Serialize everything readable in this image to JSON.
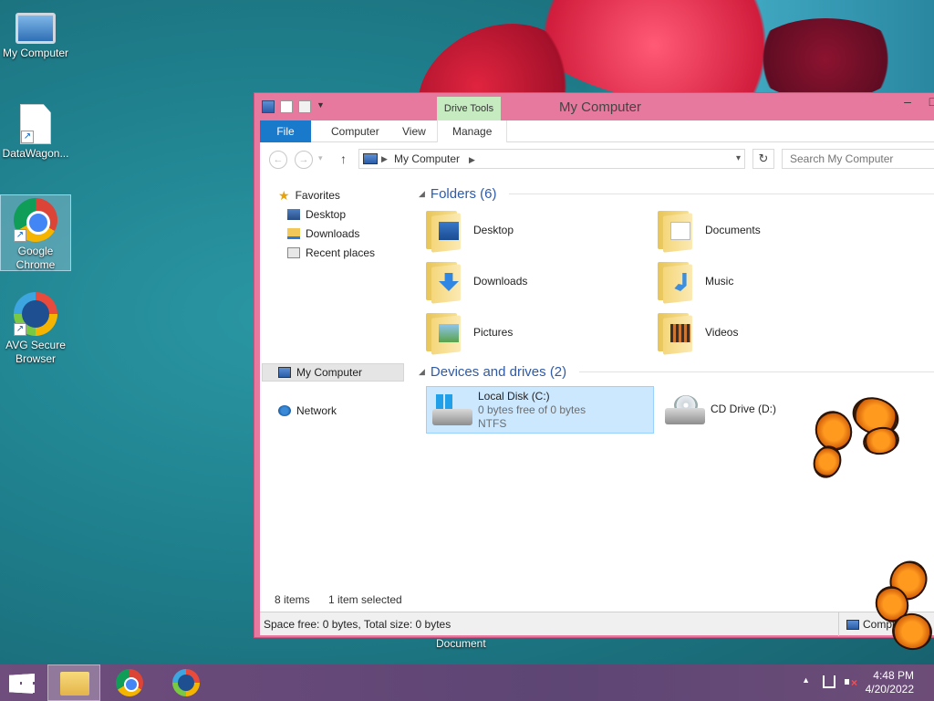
{
  "desktop": {
    "icons": [
      {
        "label": "My Computer"
      },
      {
        "label": "DataWagon..."
      },
      {
        "label": "Google Chrome"
      },
      {
        "label": "AVG Secure Browser"
      }
    ],
    "below_window_label": "Document"
  },
  "window": {
    "title": "My Computer",
    "context_tab": "Drive Tools",
    "controls": {
      "minimize": "–",
      "maximize": "□"
    },
    "ribbon_tabs": [
      {
        "label": "File"
      },
      {
        "label": "Computer"
      },
      {
        "label": "View"
      },
      {
        "label": "Manage"
      }
    ],
    "address": {
      "path": "My Computer",
      "back": "←",
      "forward": "→",
      "recent": "▾",
      "up": "↑",
      "dropdown": "▾",
      "refresh": "↻"
    },
    "search": {
      "placeholder": "Search My Computer"
    },
    "nav_pane": {
      "favorites_label": "Favorites",
      "favorites": [
        {
          "label": "Desktop"
        },
        {
          "label": "Downloads"
        },
        {
          "label": "Recent places"
        }
      ],
      "computer_label": "My Computer",
      "network_label": "Network"
    },
    "folders_group": {
      "header": "Folders (6)",
      "items": [
        {
          "label": "Desktop"
        },
        {
          "label": "Documents"
        },
        {
          "label": "Downloads"
        },
        {
          "label": "Music"
        },
        {
          "label": "Pictures"
        },
        {
          "label": "Videos"
        }
      ]
    },
    "drives_group": {
      "header": "Devices and drives (2)",
      "local_disk": {
        "name": "Local Disk (C:)",
        "space": "0 bytes free of 0 bytes",
        "fs": "NTFS"
      },
      "cd_drive": {
        "name": "CD Drive (D:)"
      }
    },
    "status": {
      "items_count": "8 items",
      "selected": "1 item selected"
    },
    "details_bar": {
      "space_text": "Space free: 0 bytes, Total size: 0 bytes",
      "right_label": "Computer"
    }
  },
  "taskbar": {
    "tray_up": "▲",
    "time": "4:48 PM",
    "date": "4/20/2022"
  },
  "colors": {
    "window_frame": "#e8799e",
    "file_tab": "#1979ca",
    "drive_tools": "#c6ebc1",
    "selected_tile": "#cce8ff",
    "taskbar": "#5d4574"
  }
}
